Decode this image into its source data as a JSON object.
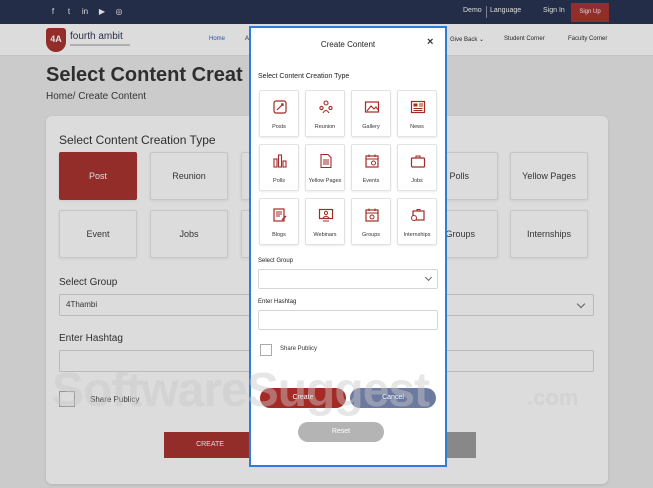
{
  "colors": {
    "brand": "#a52a26",
    "topbar": "#1f2a4a",
    "accent": "#2a58b8",
    "modal_border": "#2e7ed8",
    "cancel": "#6d7aa0",
    "reset": "#b4b4b4"
  },
  "topbar": {
    "social_icons": [
      "facebook-icon",
      "twitter-icon",
      "linkedin-icon",
      "youtube-icon",
      "instagram-icon"
    ],
    "social_glyphs": [
      "f",
      "t",
      "in",
      "▶",
      "◎"
    ],
    "demo": "Demo",
    "language": "Language",
    "sign_in": "Sign In",
    "sign_up": "Sign Up"
  },
  "nav": {
    "logo_text": "fourth ambit",
    "logo_mark": "4A",
    "home": "Home",
    "home_partial": "A",
    "give_back": "Give Back",
    "student_corner": "Student Corner",
    "faculty_corner": "Faculty Corner"
  },
  "page": {
    "title": "Select Content Creat",
    "breadcrumb": "Home/ Create Content",
    "section_title": "Select Content Creation Type",
    "tiles_left": [
      "Post",
      "Reunion",
      "Event",
      "Jobs"
    ],
    "tiles_right": [
      "Polls",
      "Yellow Pages",
      "Groups",
      "Internships"
    ],
    "select_group_label": "Select Group",
    "select_group_value": "4Thambi",
    "hashtag_label": "Enter Hashtag",
    "share_label": "Share Publicy",
    "create_label": "CREATE"
  },
  "modal": {
    "title": "Create Content",
    "close": "×",
    "section_title": "Select Content Creation Type",
    "tiles": [
      {
        "label": "Posts",
        "icon": "posts-icon"
      },
      {
        "label": "Reunion",
        "icon": "reunion-icon"
      },
      {
        "label": "Gallery",
        "icon": "gallery-icon"
      },
      {
        "label": "News",
        "icon": "news-icon"
      },
      {
        "label": "Polls",
        "icon": "polls-icon"
      },
      {
        "label": "Yellow Pages",
        "icon": "yellow-pages-icon"
      },
      {
        "label": "Events",
        "icon": "events-icon"
      },
      {
        "label": "Jobs",
        "icon": "jobs-icon"
      },
      {
        "label": "Blogs",
        "icon": "blogs-icon"
      },
      {
        "label": "Webinars",
        "icon": "webinars-icon"
      },
      {
        "label": "Groups",
        "icon": "groups-icon"
      },
      {
        "label": "Internships",
        "icon": "internships-icon"
      }
    ],
    "select_group_label": "Select Group",
    "hashtag_label": "Enter Hashtag",
    "share_label": "Share Publicy",
    "create": "Create",
    "cancel": "Cancel",
    "reset": "Reset"
  },
  "watermark": {
    "main": "SoftwareSuggest",
    "suffix": ".com"
  }
}
